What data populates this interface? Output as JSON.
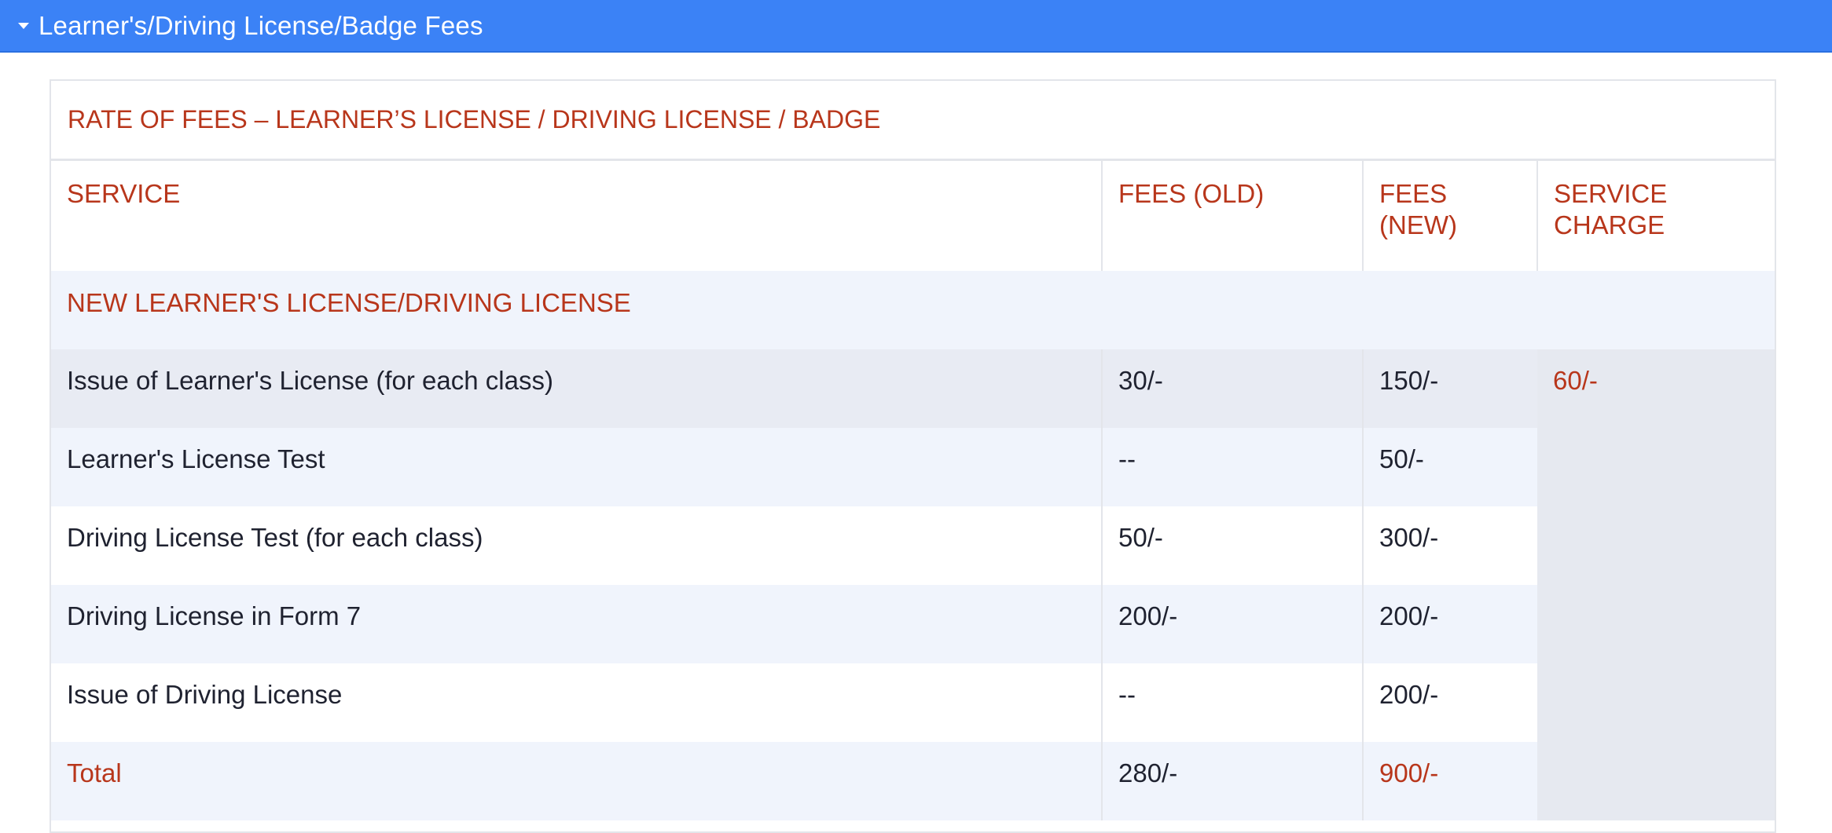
{
  "accordion": {
    "title": "Learner's/Driving License/Badge Fees"
  },
  "table": {
    "caption": "RATE OF FEES – LEARNER’S LICENSE / DRIVING LICENSE / BADGE",
    "headers": {
      "service": "SERVICE",
      "fees_old": "FEES (OLD)",
      "fees_new": "FEES (NEW)",
      "service_charge": "SERVICE CHARGE"
    },
    "section_title": "NEW LEARNER'S LICENSE/DRIVING LICENSE",
    "service_charge_value": "60/-",
    "rows": [
      {
        "service": "Issue of Learner's License (for each class)",
        "old": "30/-",
        "new": "150/-"
      },
      {
        "service": "Learner's License Test",
        "old": "--",
        "new": "50/-"
      },
      {
        "service": "Driving License Test (for each class)",
        "old": "50/-",
        "new": "300/-"
      },
      {
        "service": "Driving License in Form 7",
        "old": "200/-",
        "new": "200/-"
      },
      {
        "service": "Issue of Driving License",
        "old": "--",
        "new": "200/-"
      }
    ],
    "total": {
      "label": "Total",
      "old": "280/-",
      "new": "900/-"
    }
  },
  "colors": {
    "header_bg": "#3b82f6",
    "accent_red": "#b8361b",
    "row_tint": "#f0f4fc"
  }
}
